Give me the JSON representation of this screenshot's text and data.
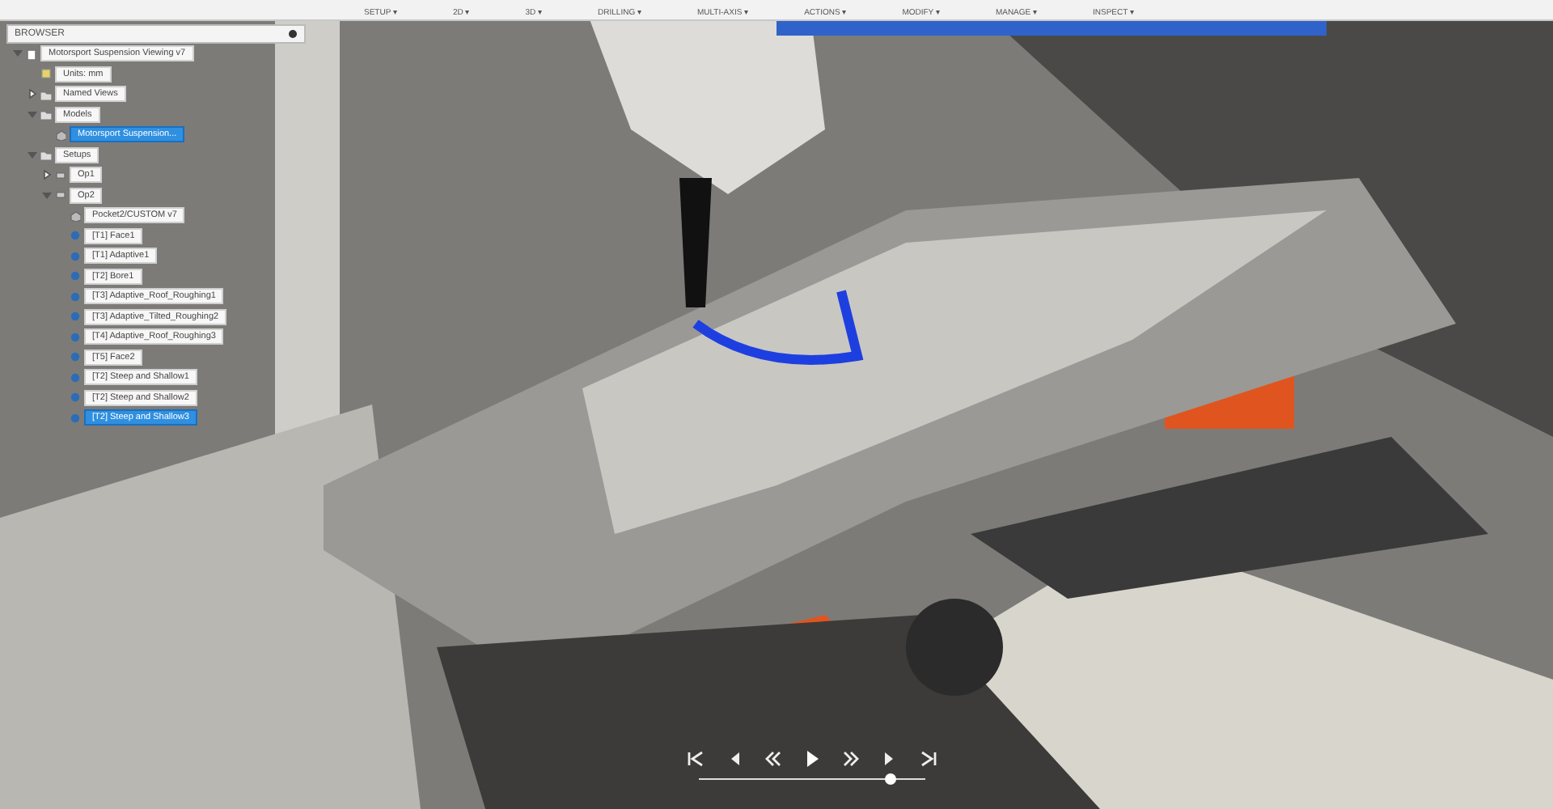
{
  "toolbar": {
    "groups": [
      {
        "label": "SETUP ▾"
      },
      {
        "label": "2D ▾"
      },
      {
        "label": "3D ▾"
      },
      {
        "label": "DRILLING ▾"
      },
      {
        "label": "MULTI-AXIS ▾"
      },
      {
        "label": "ACTIONS ▾"
      },
      {
        "label": "MODIFY ▾"
      },
      {
        "label": "MANAGE ▾"
      },
      {
        "label": "INSPECT ▾"
      }
    ]
  },
  "browser": {
    "title": "BROWSER",
    "tree": [
      {
        "label": "Motorsport Suspension Viewing v7",
        "kind": "document",
        "selected": false,
        "expanded": true,
        "children": [
          {
            "label": "Units: mm",
            "kind": "units",
            "selected": false
          },
          {
            "label": "Named Views",
            "kind": "folder",
            "selected": false,
            "expanded": false
          },
          {
            "label": "Models",
            "kind": "folder",
            "selected": false,
            "expanded": true,
            "children": [
              {
                "label": "Motorsport Suspension...",
                "kind": "model",
                "selected": true
              }
            ]
          },
          {
            "label": "Setups",
            "kind": "folder",
            "selected": false,
            "expanded": true,
            "children": [
              {
                "label": "Op1",
                "kind": "setup",
                "selected": false,
                "expanded": false
              },
              {
                "label": "Op2",
                "kind": "setup",
                "selected": false,
                "expanded": true,
                "children": [
                  {
                    "label": "Pocket2/CUSTOM v7",
                    "kind": "model",
                    "selected": false
                  },
                  {
                    "label": "[T1] Face1",
                    "kind": "operation",
                    "selected": false
                  },
                  {
                    "label": "[T1] Adaptive1",
                    "kind": "operation",
                    "selected": false
                  },
                  {
                    "label": "[T2] Bore1",
                    "kind": "operation",
                    "selected": false
                  },
                  {
                    "label": "[T3] Adaptive_Roof_Roughing1",
                    "kind": "operation",
                    "selected": false
                  },
                  {
                    "label": "[T3] Adaptive_Tilted_Roughing2",
                    "kind": "operation",
                    "selected": false
                  },
                  {
                    "label": "[T4] Adaptive_Roof_Roughing3",
                    "kind": "operation",
                    "selected": false
                  },
                  {
                    "label": "[T5] Face2",
                    "kind": "operation",
                    "selected": false
                  },
                  {
                    "label": "[T2] Steep and Shallow1",
                    "kind": "operation",
                    "selected": false
                  },
                  {
                    "label": "[T2] Steep and Shallow2",
                    "kind": "operation",
                    "selected": false
                  },
                  {
                    "label": "[T2] Steep and Shallow3",
                    "kind": "operation",
                    "selected": true
                  }
                ]
              }
            ]
          }
        ]
      }
    ]
  },
  "playback": {
    "level": 0.84
  }
}
